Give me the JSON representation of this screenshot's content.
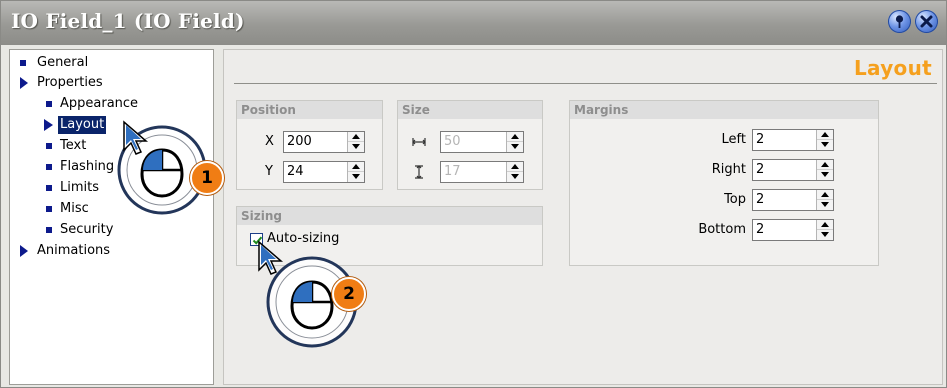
{
  "window": {
    "title": "IO Field_1 (IO Field)"
  },
  "icons": {
    "pin": "pin-icon",
    "close": "close-icon",
    "mouse": "mouse-icon"
  },
  "colors": {
    "layout_title": "#f5a01e",
    "tree_bullet": "#0d1a8c",
    "selection": "#0a246a",
    "titlebar": "#999995",
    "callout_badge": "#f07d14"
  },
  "tree": {
    "general": "General",
    "properties": "Properties",
    "appearance": "Appearance",
    "layout": "Layout",
    "text": "Text",
    "flashing": "Flashing",
    "limits": "Limits",
    "misc": "Misc",
    "security": "Security",
    "animations": "Animations"
  },
  "panel": {
    "title": "Layout",
    "position": {
      "header": "Position",
      "x_label": "X",
      "x_value": "200",
      "y_label": "Y",
      "y_value": "24"
    },
    "size": {
      "header": "Size",
      "width_value": "50",
      "height_value": "17"
    },
    "sizing": {
      "header": "Sizing",
      "autosize_label": "Auto-sizing",
      "autosize_checked": true
    },
    "margins": {
      "header": "Margins",
      "left_label": "Left",
      "left_value": "2",
      "right_label": "Right",
      "right_value": "2",
      "top_label": "Top",
      "top_value": "2",
      "bottom_label": "Bottom",
      "bottom_value": "2"
    }
  },
  "callouts": {
    "step1": "1",
    "step2": "2"
  }
}
